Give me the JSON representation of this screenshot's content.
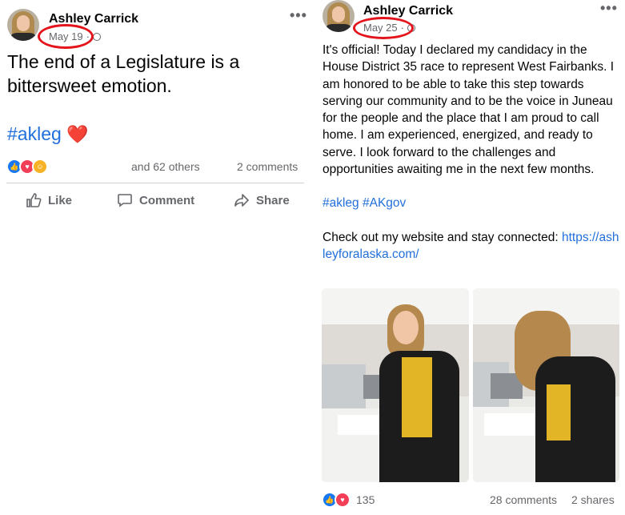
{
  "left_post": {
    "author": "Ashley Carrick",
    "date": "May 19",
    "date_suffix": "·",
    "more": "•••",
    "text": "The end of a Legislature is a bittersweet emotion.",
    "hashtag": "#akleg",
    "heart": "❤️",
    "reaction_others": "and 62 others",
    "comments": "2 comments",
    "actions": {
      "like": "Like",
      "comment": "Comment",
      "share": "Share"
    }
  },
  "right_post": {
    "author": "Ashley Carrick",
    "date": "May 25",
    "date_suffix": "·",
    "more": "•••",
    "paragraph": "It's official! Today I declared my candidacy in the House District 35 race to represent West Fairbanks. I am honored to be able to take this step towards serving our community and to be the voice in Juneau for the people and the place that I am proud to call home. I am experienced, energized, and ready to serve. I look forward to the challenges and opportunities awaiting me in the next few months.",
    "hashtags": "#akleg #AKgov",
    "website_prefix": "Check out my website and stay connected: ",
    "website_link": "https://ashleyforalaska.com/",
    "reaction_count": "135",
    "comments": "28 comments",
    "shares": "2 shares"
  },
  "colors": {
    "link": "#216fdb",
    "muted": "#65676b",
    "highlight_circle": "#e3141b"
  }
}
